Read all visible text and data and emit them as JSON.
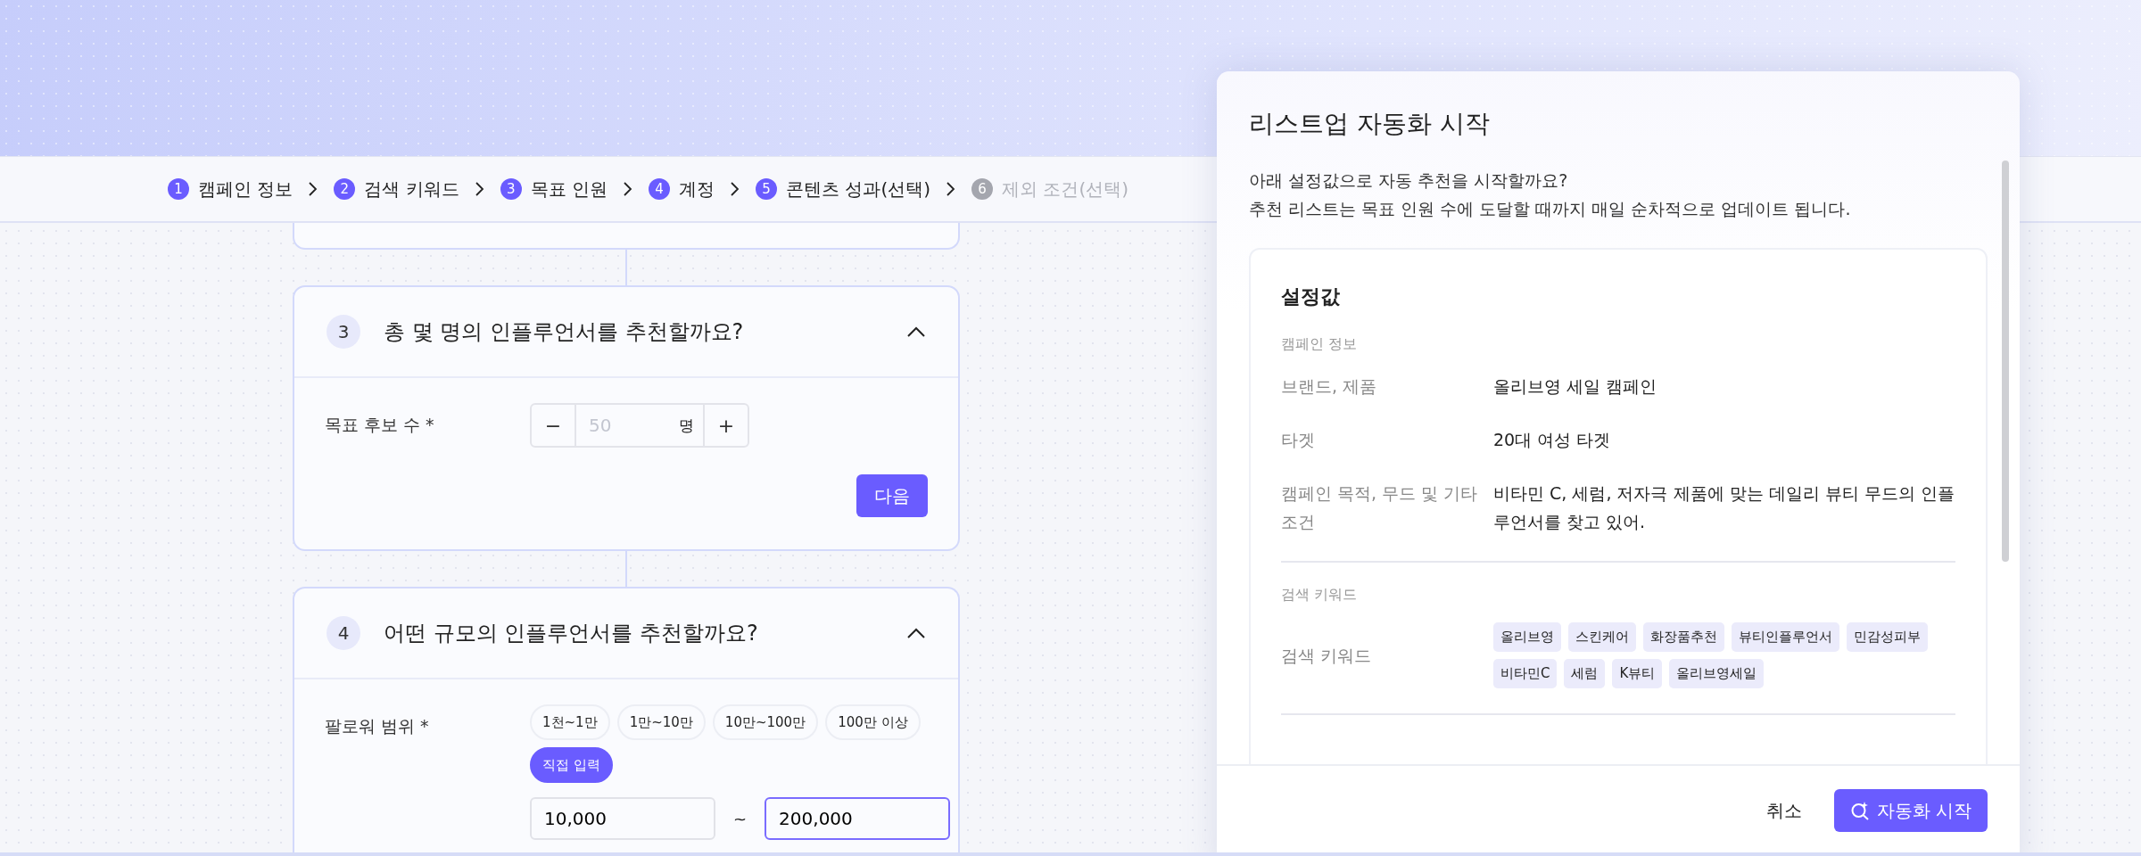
{
  "steps": [
    {
      "number": "1",
      "label": "캠페인 정보",
      "disabled": false
    },
    {
      "number": "2",
      "label": "검색 키워드",
      "disabled": false
    },
    {
      "number": "3",
      "label": "목표 인원",
      "disabled": false
    },
    {
      "number": "4",
      "label": "계정",
      "disabled": false
    },
    {
      "number": "5",
      "label": "콘텐츠 성과(선택)",
      "disabled": false
    },
    {
      "number": "6",
      "label": "제외 조건(선택)",
      "disabled": true
    }
  ],
  "target_card": {
    "number": "3",
    "title": "총 몇 명의 인플루언서를 추천할까요?",
    "expanded": true,
    "field_label": "목표 후보 수 *",
    "decrement": "−",
    "placeholder": "50",
    "unit": "명",
    "increment": "+",
    "next_button": "다음"
  },
  "scale_card": {
    "number": "4",
    "title": "어떤 규모의 인플루언서를 추천할까요?",
    "expanded": true,
    "field_label": "팔로워 범위 *",
    "chips": [
      {
        "label": "1천~1만",
        "selected": false
      },
      {
        "label": "1만~10만",
        "selected": false
      },
      {
        "label": "10만~100만",
        "selected": false
      },
      {
        "label": "100만 이상",
        "selected": false
      },
      {
        "label": "직접 입력",
        "selected": true
      }
    ],
    "range_min": {
      "value": "10,000",
      "focused": false
    },
    "separator": "~",
    "range_max": {
      "value": "200,000",
      "focused": true
    }
  },
  "dialog": {
    "title": "리스트업 자동화 시작",
    "description": [
      "아래 설정값으로 자동 추천을 시작할까요?",
      "추천 리스트는 목표 인원 수에 도달할 때까지 매일 순차적으로 업데이트 됩니다."
    ],
    "summary": {
      "title": "설정값",
      "sections": [
        {
          "heading": "캠페인 정보",
          "rows": [
            {
              "kind": "text",
              "label": "브랜드, 제품",
              "value": "올리브영 세일 캠페인"
            },
            {
              "kind": "text",
              "label": "타겟",
              "value": "20대 여성 타겟"
            },
            {
              "kind": "text",
              "label": "캠페인 목적, 무드 및 기타 조건",
              "value": "비타민 C, 세럼, 저자극 제품에 맞는 데일리 뷰티 무드의 인플루언서를 찾고 있어."
            }
          ]
        },
        {
          "heading": "검색 키워드",
          "rows": [
            {
              "kind": "tags",
              "label": "검색 키워드",
              "tags": [
                "올리브영",
                "스킨케어",
                "화장품추천",
                "뷰티인플루언서",
                "민감성피부",
                "비타민C",
                "세럼",
                "K뷰티",
                "올리브영세일"
              ]
            }
          ]
        }
      ]
    },
    "cancel_button": "취소",
    "start_button": "자동화 시작"
  }
}
